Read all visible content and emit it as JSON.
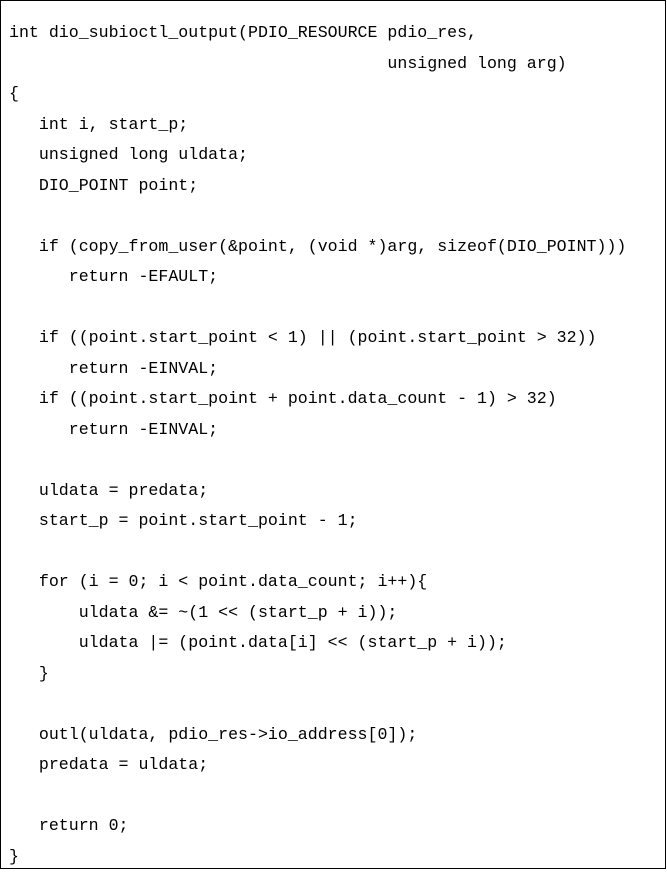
{
  "document": {
    "type": "code-listing",
    "language": "C",
    "lines": [
      "int dio_subioctl_output(PDIO_RESOURCE pdio_res,",
      "                                      unsigned long arg)",
      "{",
      "   int i, start_p;",
      "   unsigned long uldata;",
      "   DIO_POINT point;",
      "",
      "   if (copy_from_user(&point, (void *)arg, sizeof(DIO_POINT)))",
      "      return -EFAULT;",
      "",
      "   if ((point.start_point < 1) || (point.start_point > 32))",
      "      return -EINVAL;",
      "   if ((point.start_point + point.data_count - 1) > 32)",
      "      return -EINVAL;",
      "",
      "   uldata = predata;",
      "   start_p = point.start_point - 1;",
      "",
      "   for (i = 0; i < point.data_count; i++){",
      "       uldata &= ~(1 << (start_p + i));",
      "       uldata |= (point.data[i] << (start_p + i));",
      "   }",
      "",
      "   outl(uldata, pdio_res->io_address[0]);",
      "   predata = uldata;",
      "",
      "   return 0;",
      "}"
    ]
  }
}
